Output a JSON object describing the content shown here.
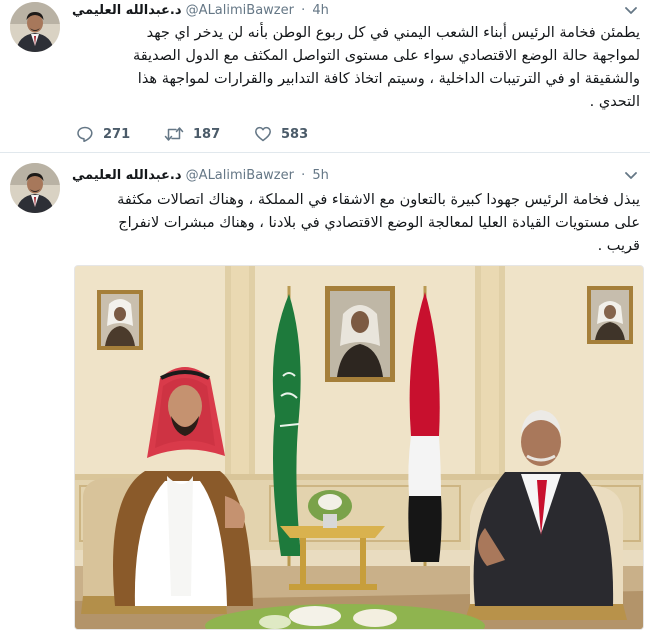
{
  "tweets": [
    {
      "name": "د.عبدالله العليمي",
      "handle": "@ALalimiBawzer",
      "time": "4h",
      "text_lines": [
        "يطمئن فخامة الرئيس أبناء الشعب اليمني في كل ربوع الوطن بأنه لن يدخر اي جهد",
        "لمواجهة حالة الوضع الاقتصادي سواء على مستوى التواصل المكثف مع الدول الصديقة",
        "والشقيقة او في الترتيبات الداخلية ، وسيتم اتخاذ  كافة التدابير والقرارات لمواجهة هذا",
        "التحدي ."
      ],
      "replies": "271",
      "retweets": "187",
      "likes": "583"
    },
    {
      "name": "د.عبدالله العليمي",
      "handle": "@ALalimiBawzer",
      "time": "5h",
      "text_lines": [
        "يبذل فخامة الرئيس جهودا كبيرة بالتعاون مع الاشقاء في المملكة ، وهناك اتصالات مكثفة",
        "على مستويات القيادة العليا لمعالجة الوضع  الاقتصادي في بلادنا ، وهناك مبشرات لانفراج",
        "قريب ."
      ]
    }
  ],
  "icons": {
    "reply": "reply-icon",
    "retweet": "retweet-icon",
    "like": "heart-icon",
    "menu": "chevron-down-icon"
  },
  "colors": {
    "text": "#14171a",
    "secondary": "#657786",
    "saudi_flag": "#1e7a3c",
    "yemen_red": "#c8102e"
  }
}
